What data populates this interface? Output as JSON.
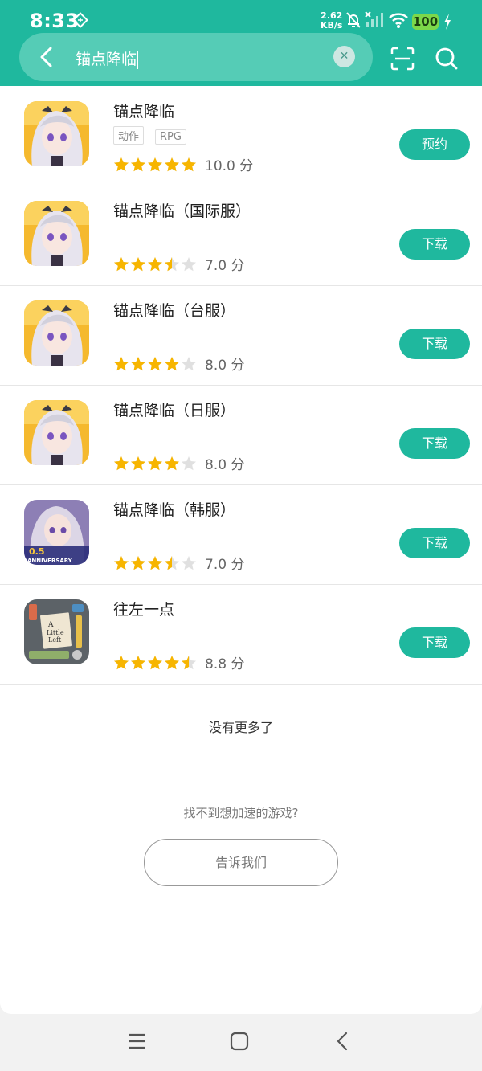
{
  "status": {
    "time": "8:33",
    "net_speed_value": "2.62",
    "net_speed_unit": "KB/s",
    "battery": "100"
  },
  "search": {
    "query": "锚点降临",
    "icons": [
      "back-arrow-icon",
      "clear-icon",
      "scan-icon",
      "search-icon"
    ]
  },
  "results": [
    {
      "name": "锚点降临",
      "tags": [
        "动作",
        "RPG"
      ],
      "rating": 5,
      "score": "10.0 分",
      "action": "预约"
    },
    {
      "name": "锚点降临（国际服）",
      "tags": [],
      "rating": 3.5,
      "score": "7.0 分",
      "action": "下载"
    },
    {
      "name": "锚点降临（台服）",
      "tags": [],
      "rating": 4,
      "score": "8.0 分",
      "action": "下载"
    },
    {
      "name": "锚点降临（日服）",
      "tags": [],
      "rating": 4,
      "score": "8.0 分",
      "action": "下载"
    },
    {
      "name": "锚点降临（韩服）",
      "tags": [],
      "rating": 3.5,
      "score": "7.0 分",
      "action": "下载",
      "icon_badge": "0.5 ANNIVERSARY"
    },
    {
      "name": "往左一点",
      "tags": [],
      "rating": 4.5,
      "score": "8.8 分",
      "action": "下载",
      "icon_badge": "A Little to the Left"
    }
  ],
  "footer": {
    "no_more": "没有更多了",
    "cant_find": "找不到想加速的游戏?",
    "tell_us": "告诉我们"
  },
  "colors": {
    "accent": "#1fb89e",
    "star": "#f7b500",
    "star_empty": "#e0e0e0"
  }
}
